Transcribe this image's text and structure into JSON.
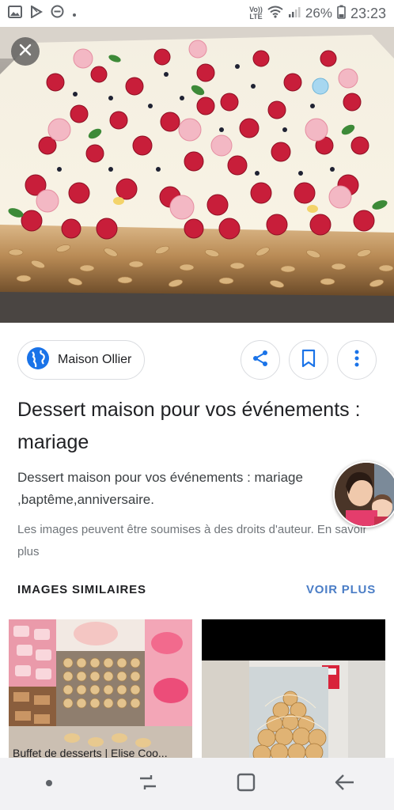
{
  "status_bar": {
    "volte_line1": "Vo))",
    "volte_line2": "LTE",
    "battery": "26%",
    "time": "23:23",
    "icons": [
      "gallery-icon",
      "play-store-icon",
      "do-not-disturb-icon",
      "wifi-icon",
      "signal-icon",
      "battery-icon"
    ]
  },
  "source": {
    "name": "Maison Ollier",
    "icon": "globe-icon"
  },
  "actions": {
    "share_icon": "share-icon",
    "save_icon": "bookmark-icon",
    "more_icon": "more-vert-icon",
    "close_icon": "close-icon"
  },
  "title": "Dessert maison pour vos événements : mariage",
  "description": "Dessert maison pour vos événements : mariage ,baptême,anniversaire.",
  "copyright_notice": "Les images peuvent être soumises à des droits d'auteur. En savoir plus",
  "similar": {
    "header": "IMAGES SIMILAIRES",
    "see_more": "VOIR PLUS",
    "items": [
      {
        "caption": "Buffet de desserts | Elise Coo..."
      },
      {
        "caption": ""
      }
    ]
  },
  "nav": {
    "icons": [
      "dot-icon",
      "recent-apps-icon",
      "home-icon",
      "back-icon"
    ]
  },
  "colors": {
    "accent_link": "#4a7dc6",
    "share_blue": "#1a73e8",
    "globe_blue": "#1a73e8",
    "border": "#dadce0"
  }
}
